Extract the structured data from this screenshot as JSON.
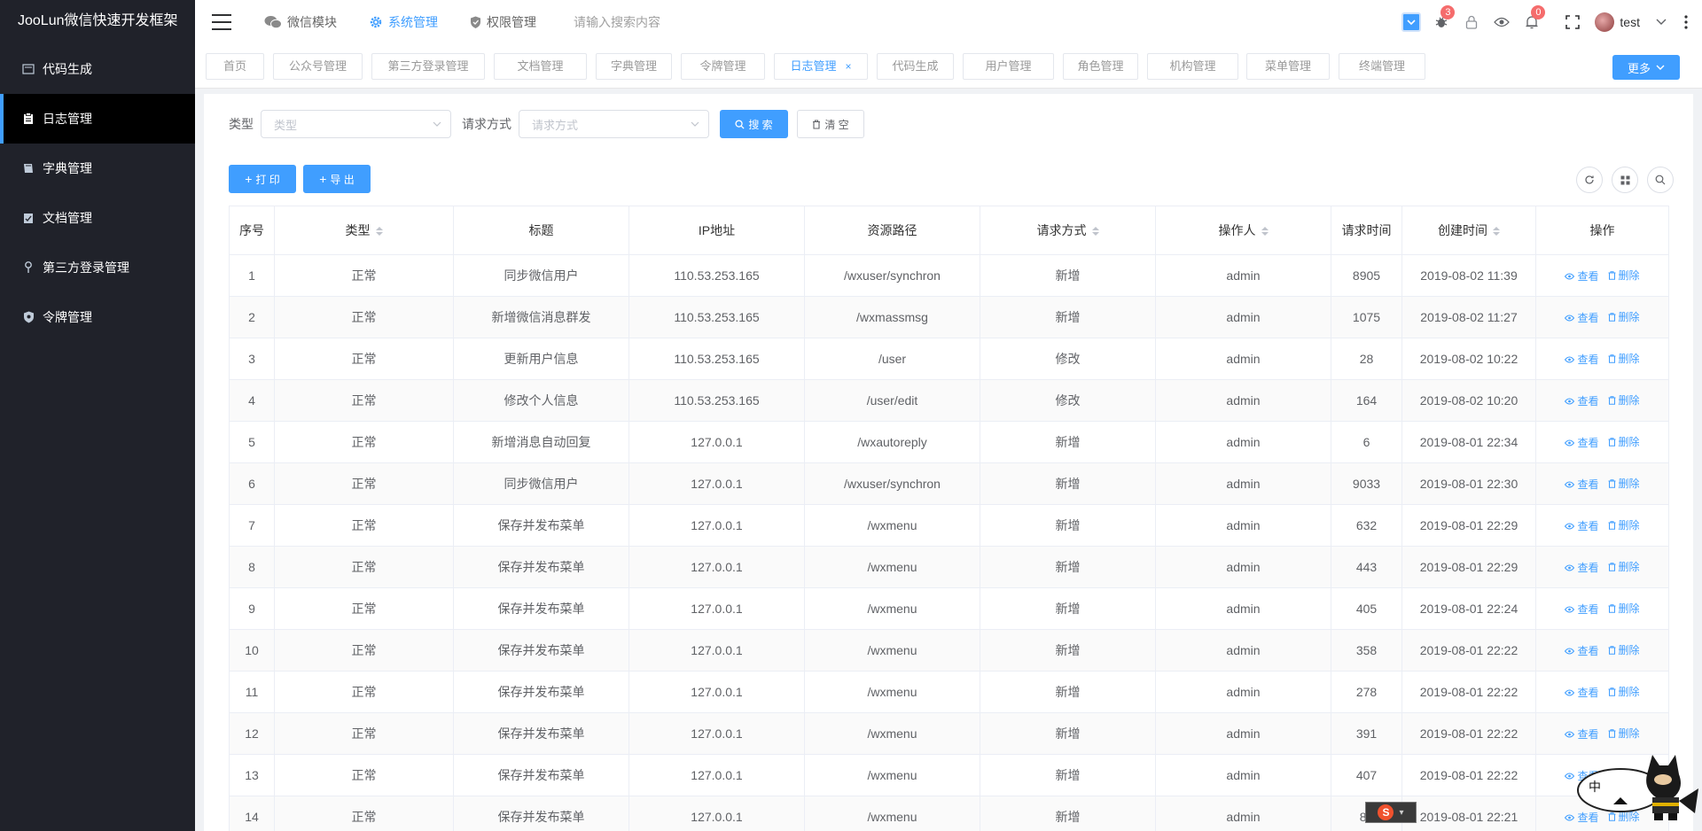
{
  "app": {
    "title": "JooLun微信快速开发框架"
  },
  "sidebar": {
    "items": [
      {
        "label": "代码生成",
        "icon": "code-icon",
        "active": false
      },
      {
        "label": "日志管理",
        "icon": "clipboard-icon",
        "active": true
      },
      {
        "label": "字典管理",
        "icon": "book-icon",
        "active": false
      },
      {
        "label": "文档管理",
        "icon": "checklist-icon",
        "active": false
      },
      {
        "label": "第三方登录管理",
        "icon": "pin-icon",
        "active": false
      },
      {
        "label": "令牌管理",
        "icon": "shield-icon",
        "active": false
      }
    ]
  },
  "header": {
    "nav": [
      {
        "label": "微信模块",
        "icon": "wechat-icon",
        "active": false
      },
      {
        "label": "系统管理",
        "icon": "gear-icon",
        "active": true
      },
      {
        "label": "权限管理",
        "icon": "shield-icon",
        "active": false
      }
    ],
    "search_placeholder": "请输入搜索内容",
    "bug_badge": "3",
    "bell_badge": "0",
    "username": "test"
  },
  "tags": {
    "items": [
      {
        "label": "首页"
      },
      {
        "label": "公众号管理"
      },
      {
        "label": "第三方登录管理"
      },
      {
        "label": "文档管理"
      },
      {
        "label": "字典管理"
      },
      {
        "label": "令牌管理"
      },
      {
        "label": "日志管理",
        "active": true,
        "close": "×"
      },
      {
        "label": "代码生成"
      },
      {
        "label": "用户管理"
      },
      {
        "label": "角色管理"
      },
      {
        "label": "机构管理"
      },
      {
        "label": "菜单管理"
      },
      {
        "label": "终端管理"
      }
    ],
    "more_label": "更多"
  },
  "filters": {
    "type_label": "类型",
    "type_placeholder": "类型",
    "method_label": "请求方式",
    "method_placeholder": "请求方式",
    "search_label": "搜 索",
    "clear_label": "清 空"
  },
  "toolbar": {
    "print_label": "打 印",
    "export_label": "导 出"
  },
  "table": {
    "columns": [
      "序号",
      "类型",
      "标题",
      "IP地址",
      "资源路径",
      "请求方式",
      "操作人",
      "请求时间",
      "创建时间",
      "操作"
    ],
    "sortable": [
      false,
      true,
      false,
      false,
      false,
      true,
      true,
      false,
      true,
      false
    ],
    "view_label": "查看",
    "delete_label": "删除",
    "rows": [
      [
        "1",
        "正常",
        "同步微信用户",
        "110.53.253.165",
        "/wxuser/synchron",
        "新增",
        "admin",
        "8905",
        "2019-08-02 11:39"
      ],
      [
        "2",
        "正常",
        "新增微信消息群发",
        "110.53.253.165",
        "/wxmassmsg",
        "新增",
        "admin",
        "1075",
        "2019-08-02 11:27"
      ],
      [
        "3",
        "正常",
        "更新用户信息",
        "110.53.253.165",
        "/user",
        "修改",
        "admin",
        "28",
        "2019-08-02 10:22"
      ],
      [
        "4",
        "正常",
        "修改个人信息",
        "110.53.253.165",
        "/user/edit",
        "修改",
        "admin",
        "164",
        "2019-08-02 10:20"
      ],
      [
        "5",
        "正常",
        "新增消息自动回复",
        "127.0.0.1",
        "/wxautoreply",
        "新增",
        "admin",
        "6",
        "2019-08-01 22:34"
      ],
      [
        "6",
        "正常",
        "同步微信用户",
        "127.0.0.1",
        "/wxuser/synchron",
        "新增",
        "admin",
        "9033",
        "2019-08-01 22:30"
      ],
      [
        "7",
        "正常",
        "保存并发布菜单",
        "127.0.0.1",
        "/wxmenu",
        "新增",
        "admin",
        "632",
        "2019-08-01 22:29"
      ],
      [
        "8",
        "正常",
        "保存并发布菜单",
        "127.0.0.1",
        "/wxmenu",
        "新增",
        "admin",
        "443",
        "2019-08-01 22:29"
      ],
      [
        "9",
        "正常",
        "保存并发布菜单",
        "127.0.0.1",
        "/wxmenu",
        "新增",
        "admin",
        "405",
        "2019-08-01 22:24"
      ],
      [
        "10",
        "正常",
        "保存并发布菜单",
        "127.0.0.1",
        "/wxmenu",
        "新增",
        "admin",
        "358",
        "2019-08-01 22:22"
      ],
      [
        "11",
        "正常",
        "保存并发布菜单",
        "127.0.0.1",
        "/wxmenu",
        "新增",
        "admin",
        "278",
        "2019-08-01 22:22"
      ],
      [
        "12",
        "正常",
        "保存并发布菜单",
        "127.0.0.1",
        "/wxmenu",
        "新增",
        "admin",
        "391",
        "2019-08-01 22:22"
      ],
      [
        "13",
        "正常",
        "保存并发布菜单",
        "127.0.0.1",
        "/wxmenu",
        "新增",
        "admin",
        "407",
        "2019-08-01 22:22"
      ],
      [
        "14",
        "正常",
        "保存并发布菜单",
        "127.0.0.1",
        "/wxmenu",
        "新增",
        "admin",
        "82",
        "2019-08-01 22:21"
      ]
    ]
  },
  "ime": {
    "mode": "中",
    "logo": "S"
  },
  "colors": {
    "accent": "#409eff",
    "sidebar_bg": "#20222a",
    "badge": "#f56c6c"
  }
}
